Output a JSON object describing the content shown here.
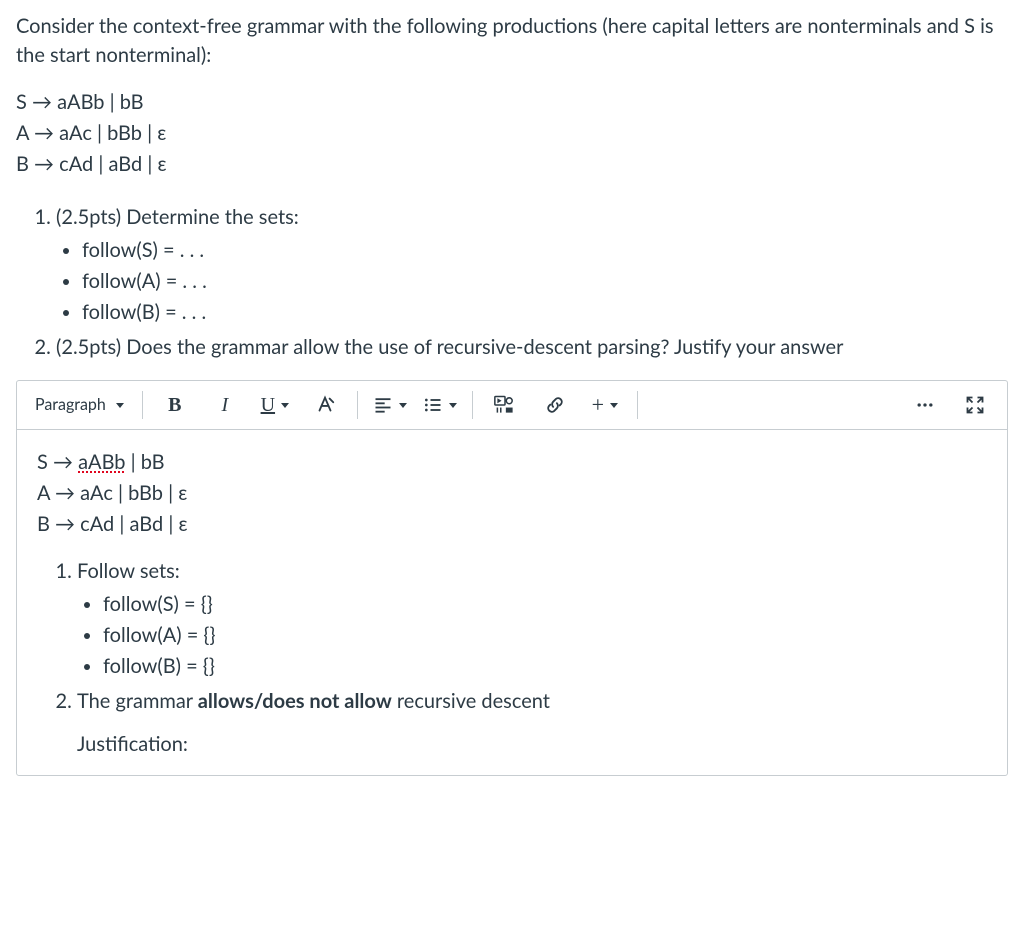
{
  "question": {
    "intro": "Consider the context-free grammar with the following productions (here capital letters are nonterminals and S is the start nonterminal):",
    "grammar": {
      "line1": "S → aABb | bB",
      "line2": "A → aAc | bBb | ε",
      "line3": "B → cAd | aBd | ε"
    },
    "parts": {
      "p1_label": "(2.5pts) Determine the sets:",
      "p1_items": {
        "i1": "follow(S) = . . .",
        "i2": "follow(A) = . . .",
        "i3": "follow(B) = . . ."
      },
      "p2_label": "(2.5pts) Does the grammar allow the use of recursive-descent parsing? Justify your answer"
    }
  },
  "toolbar": {
    "block_type": "Paragraph",
    "bold": "B",
    "italic": "I",
    "underline": "U",
    "plus": "+"
  },
  "answer": {
    "g1_pre": "S → ",
    "g1_spell": "aABb",
    "g1_post": " | bB",
    "g2": "A → aAc | bBb | ε",
    "g3": "B → cAd | aBd | ε",
    "p1_label": "Follow sets:",
    "p1_items": {
      "i1": "follow(S) = {}",
      "i2": "follow(A) = {}",
      "i3": "follow(B) = {}"
    },
    "p2_pre": "The grammar ",
    "p2_bold": "allows/does not allow",
    "p2_post": " recursive descent",
    "justification_label": "Justification:"
  }
}
